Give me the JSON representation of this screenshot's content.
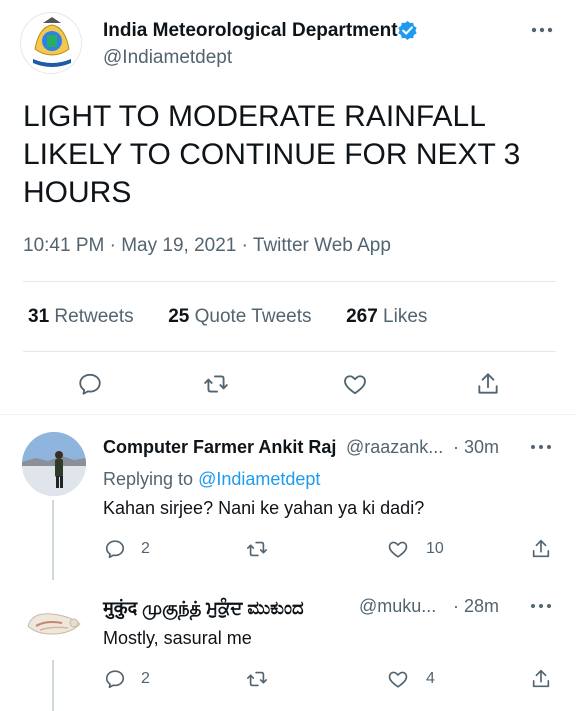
{
  "tweet": {
    "author_name": "India Meteorological Department",
    "handle": "@Indiametdept",
    "text": "LIGHT TO MODERATE RAINFALL LIKELY TO CONTINUE FOR NEXT 3 HOURS",
    "time": "10:41 PM",
    "date": "May 19, 2021",
    "source": "Twitter Web App",
    "separator": "·",
    "retweets": "31",
    "retweets_label": "Retweets",
    "quote_tweets": "25",
    "quote_tweets_label": "Quote Tweets",
    "likes": "267",
    "likes_label": "Likes"
  },
  "replies": [
    {
      "name": "Computer Farmer Ankit Raj",
      "handle": "@raazank...",
      "time": "· 30m",
      "replying_prefix": "Replying to",
      "replying_to": "@Indiametdept",
      "text": "Kahan sirjee? Nani ke yahan ya ki dadi?",
      "replies": "2",
      "likes": "10"
    },
    {
      "name": "मुकुंद முகுந்த் ਮੁਕੁੰਦ ಮುಕುಂದ",
      "handle": "@muku...",
      "time": "· 28m",
      "text": "Mostly, sasural me",
      "replies": "2",
      "likes": "4"
    }
  ],
  "colors": {
    "accent": "#1d9bf0",
    "text": "#0f1419",
    "secondary": "#536471",
    "divider": "#e5e8eb"
  },
  "icons": [
    "verified-badge-icon",
    "more-icon",
    "reply-icon",
    "retweet-icon",
    "like-icon",
    "share-icon"
  ]
}
